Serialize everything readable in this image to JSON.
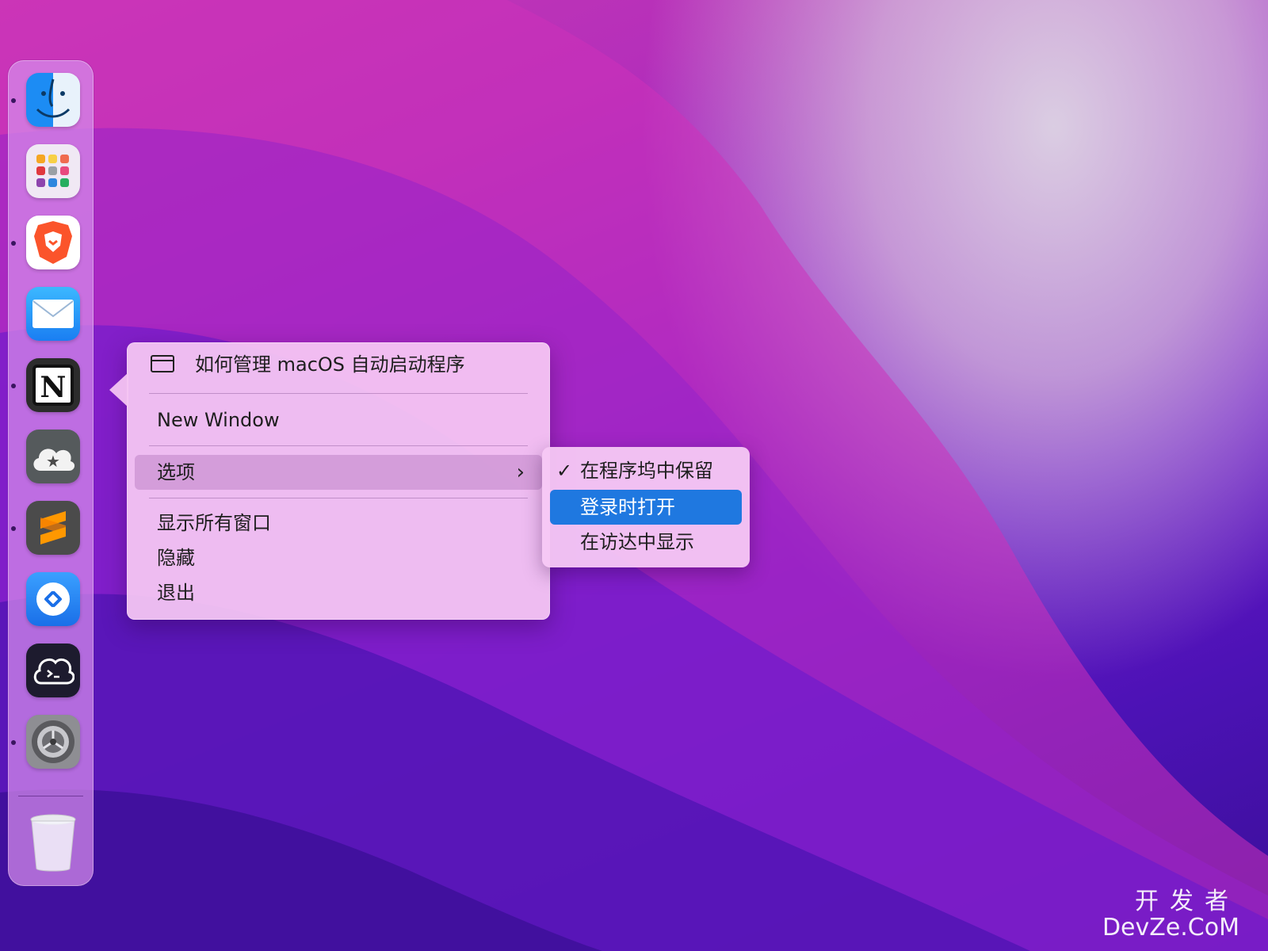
{
  "dock": {
    "apps": [
      {
        "name": "finder",
        "running": true
      },
      {
        "name": "launchpad",
        "running": false
      },
      {
        "name": "brave",
        "running": true
      },
      {
        "name": "mail",
        "running": false
      },
      {
        "name": "notion",
        "running": true
      },
      {
        "name": "cloud-star",
        "running": false
      },
      {
        "name": "sublime-text",
        "running": true
      },
      {
        "name": "remote-desktop",
        "running": false
      },
      {
        "name": "termius",
        "running": false
      },
      {
        "name": "system-preferences",
        "running": true
      }
    ],
    "trash": {
      "name": "trash"
    }
  },
  "context_menu": {
    "window_item": "如何管理 macOS 自动启动程序",
    "new_window": "New Window",
    "options": "选项",
    "options_chevron": "›",
    "show_all_windows": "显示所有窗口",
    "hide": "隐藏",
    "quit": "退出"
  },
  "submenu": {
    "keep_in_dock": "在程序坞中保留",
    "keep_in_dock_checked": true,
    "check_glyph": "✓",
    "open_at_login": "登录时打开",
    "show_in_finder": "在访达中显示"
  },
  "watermark": {
    "line1": "开发者",
    "line2": "DevZe.CoM"
  },
  "colors": {
    "selection_blue": "#1f78e0",
    "menu_bg": "#f6c8f4"
  }
}
